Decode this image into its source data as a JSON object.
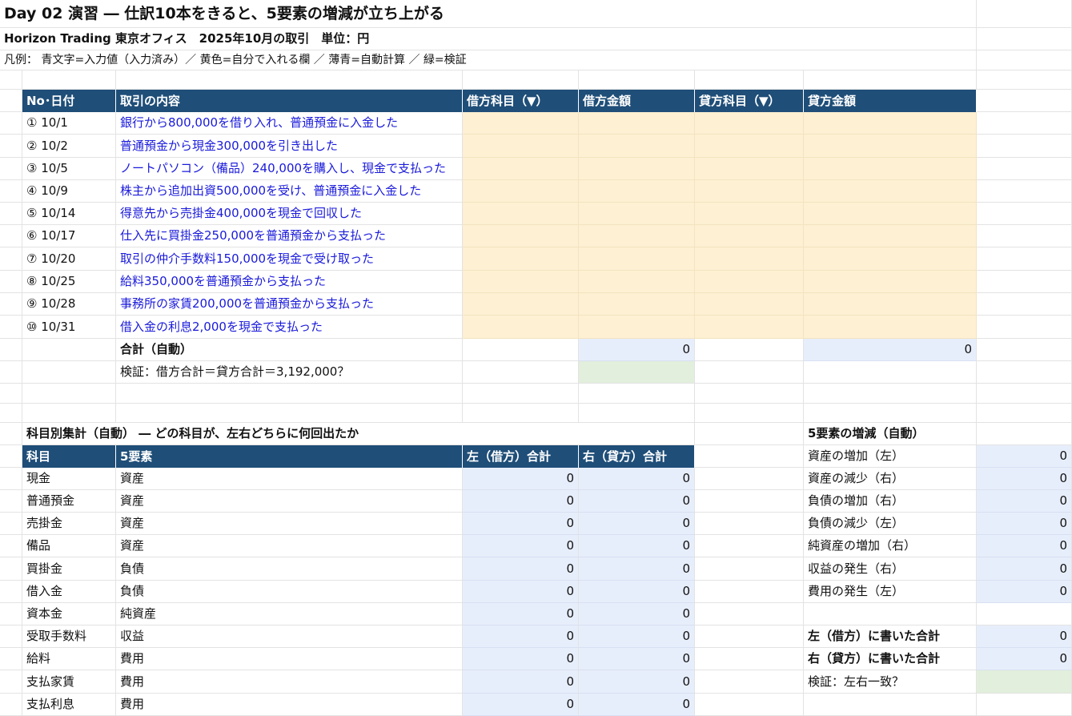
{
  "sheet": {
    "title": "Day 02 演習 ― 仕訳10本をきると、5要素の増減が立ち上がる",
    "subtitle": "Horizon Trading 東京オフィス　2025年10月の取引　単位：円",
    "legend": "凡例： 青文字=入力値（入力済み）／ 黄色=自分で入れる欄 ／ 薄青=自動計算 ／ 緑=検証"
  },
  "journal": {
    "headers": [
      "No･日付",
      "取引の内容",
      "借方科目（▼）",
      "借方金額",
      "貸方科目（▼）",
      "貸方金額"
    ],
    "rows": [
      {
        "no": "① 10/1",
        "desc": "銀行から800,000を借り入れ、普通預金に入金した"
      },
      {
        "no": "② 10/2",
        "desc": "普通預金から現金300,000を引き出した"
      },
      {
        "no": "③ 10/5",
        "desc": "ノートパソコン（備品）240,000を購入し、現金で支払った"
      },
      {
        "no": "④ 10/9",
        "desc": "株主から追加出資500,000を受け、普通預金に入金した"
      },
      {
        "no": "⑤ 10/14",
        "desc": "得意先から売掛金400,000を現金で回収した"
      },
      {
        "no": "⑥ 10/17",
        "desc": "仕入先に買掛金250,000を普通預金から支払った"
      },
      {
        "no": "⑦ 10/20",
        "desc": "取引の仲介手数料150,000を現金で受け取った"
      },
      {
        "no": "⑧ 10/25",
        "desc": "給料350,000を普通預金から支払った"
      },
      {
        "no": "⑨ 10/28",
        "desc": "事務所の家賃200,000を普通預金から支払った"
      },
      {
        "no": "⑩ 10/31",
        "desc": "借入金の利息2,000を現金で支払った"
      }
    ],
    "total_label": "合計（自動）",
    "total_debit": "0",
    "total_credit": "0",
    "check_label": "検証：借方合計＝貸方合計＝3,192,000？"
  },
  "summary": {
    "title": "科目別集計（自動） ― どの科目が、左右どちらに何回出たか",
    "headers": [
      "科目",
      "5要素",
      "左（借方）合計",
      "右（貸方）合計"
    ],
    "rows": [
      {
        "account": "現金",
        "element": "資産",
        "left": "0",
        "right": "0"
      },
      {
        "account": "普通預金",
        "element": "資産",
        "left": "0",
        "right": "0"
      },
      {
        "account": "売掛金",
        "element": "資産",
        "left": "0",
        "right": "0"
      },
      {
        "account": "備品",
        "element": "資産",
        "left": "0",
        "right": "0"
      },
      {
        "account": "買掛金",
        "element": "負債",
        "left": "0",
        "right": "0"
      },
      {
        "account": "借入金",
        "element": "負債",
        "left": "0",
        "right": "0"
      },
      {
        "account": "資本金",
        "element": "純資産",
        "left": "0",
        "right": "0"
      },
      {
        "account": "受取手数料",
        "element": "収益",
        "left": "0",
        "right": "0"
      },
      {
        "account": "給料",
        "element": "費用",
        "left": "0",
        "right": "0"
      },
      {
        "account": "支払家賃",
        "element": "費用",
        "left": "0",
        "right": "0"
      },
      {
        "account": "支払利息",
        "element": "費用",
        "left": "0",
        "right": "0"
      }
    ]
  },
  "elements": {
    "title": "5要素の増減（自動）",
    "rows": [
      {
        "label": "資産の増加（左）",
        "value": "0"
      },
      {
        "label": "資産の減少（右）",
        "value": "0"
      },
      {
        "label": "負債の増加（右）",
        "value": "0"
      },
      {
        "label": "負債の減少（左）",
        "value": "0"
      },
      {
        "label": "純資産の増加（右）",
        "value": "0"
      },
      {
        "label": "収益の発生（右）",
        "value": "0"
      },
      {
        "label": "費用の発生（左）",
        "value": "0"
      }
    ],
    "left_total_label": "左（借方）に書いた合計",
    "left_total_value": "0",
    "right_total_label": "右（貸方）に書いた合計",
    "right_total_value": "0",
    "check_label": "検証：左右一致？"
  },
  "colors": {
    "header_bg": "#1f4e78",
    "input_fill": "#fdf0d3",
    "auto_calc_fill": "#e7eefb",
    "check_fill": "#e2efdc",
    "input_text": "#1a1adb"
  }
}
